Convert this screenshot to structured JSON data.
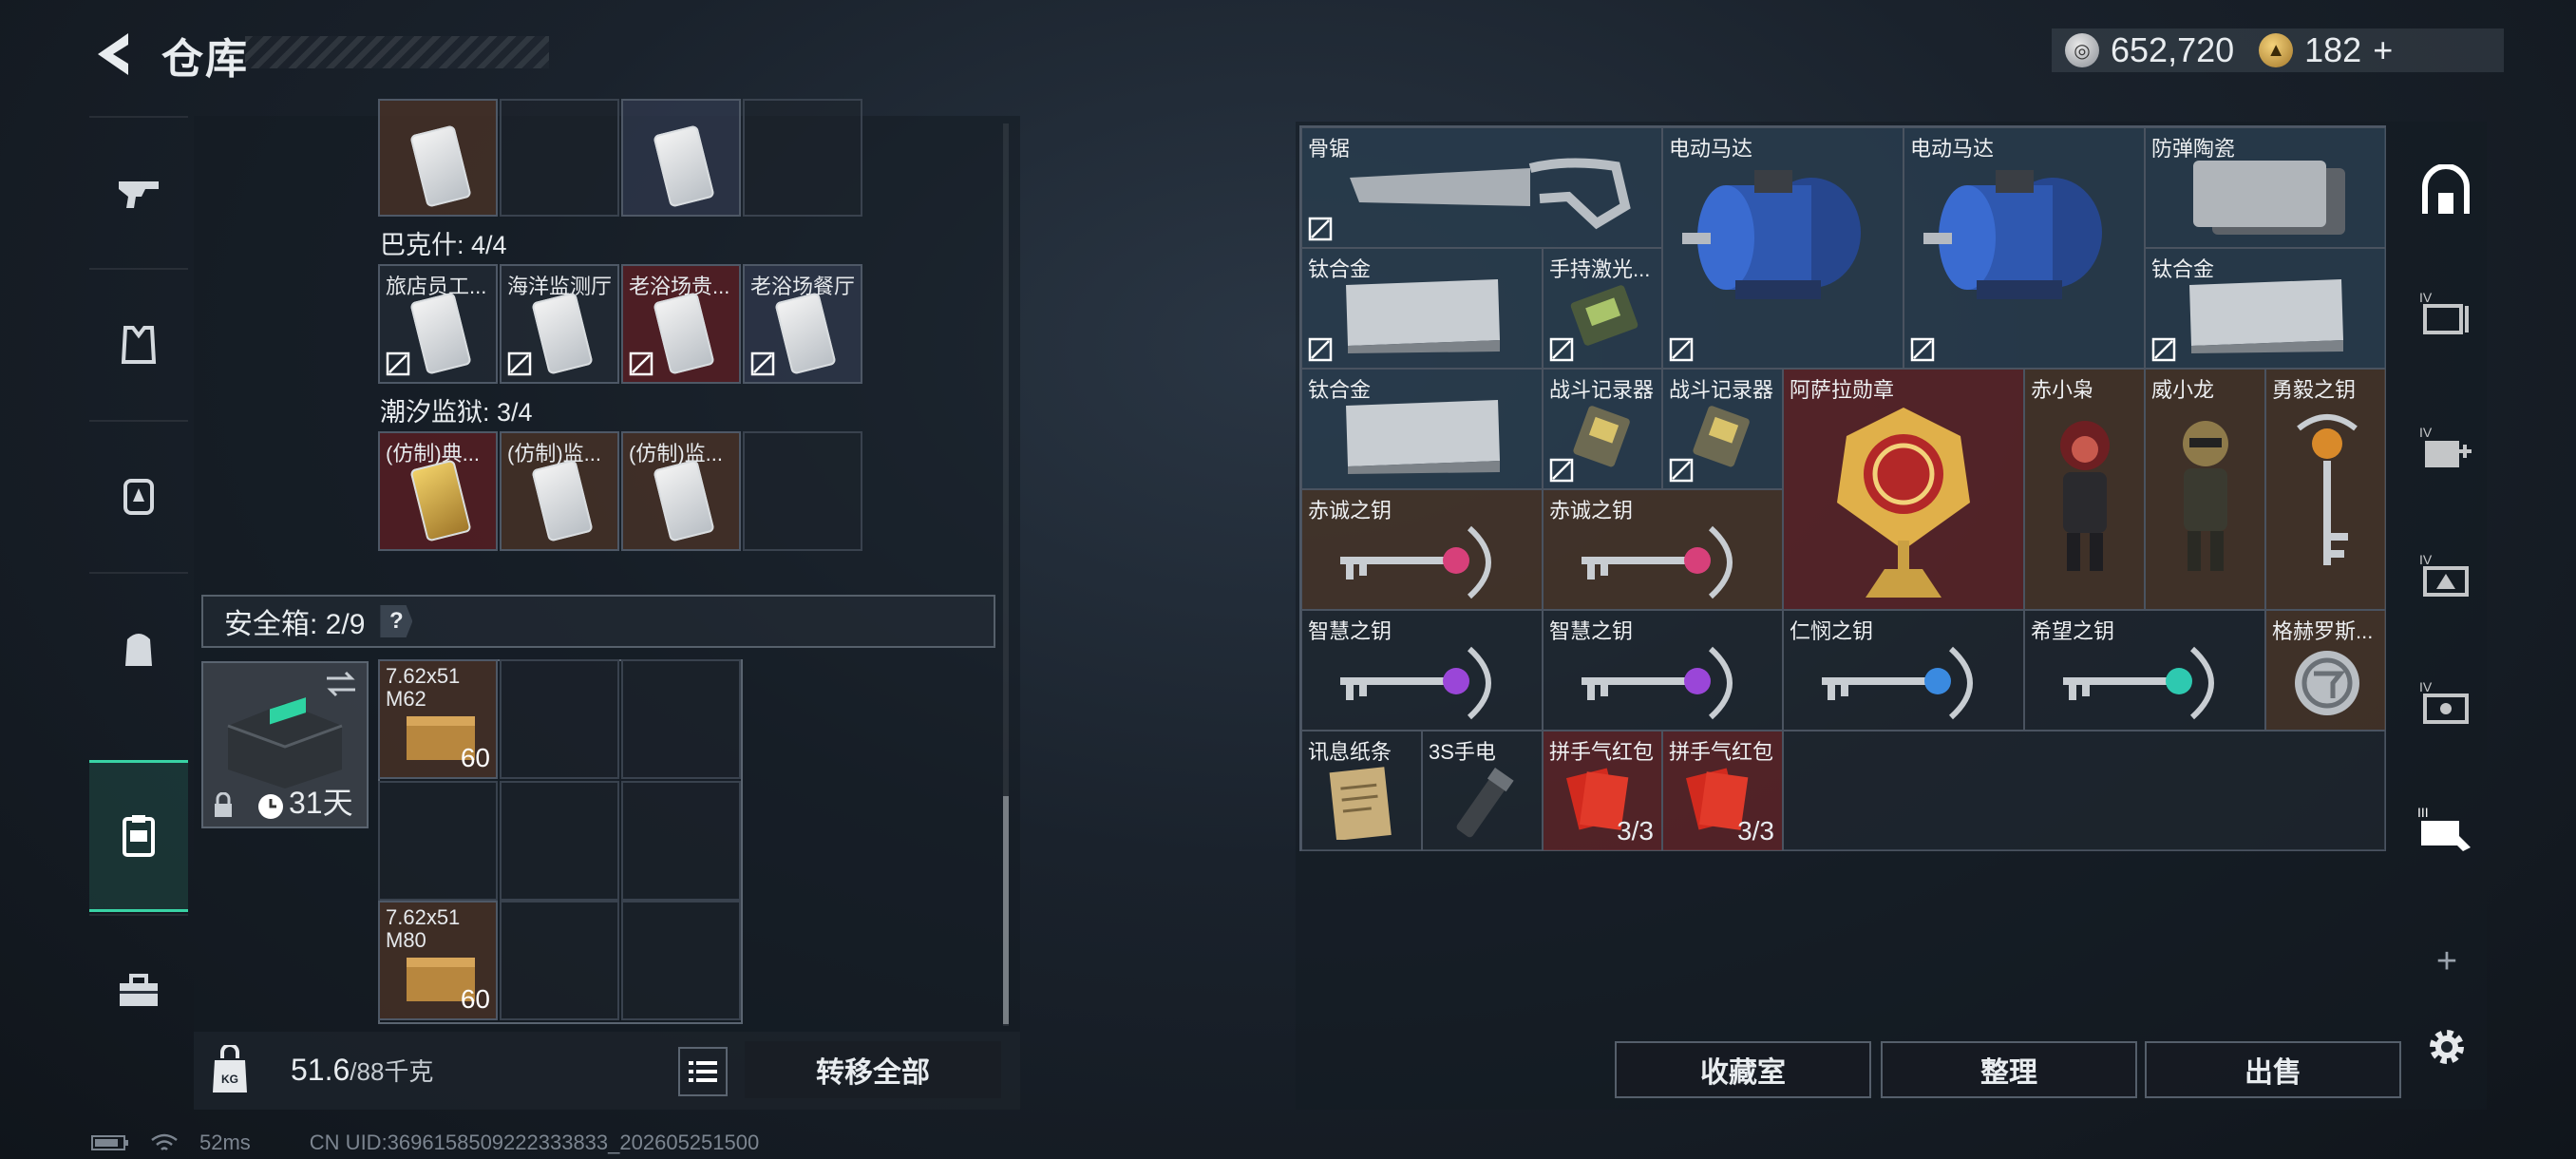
{
  "header": {
    "title": "仓库",
    "silver": "652,720",
    "gold": "182",
    "gold_plus": "+"
  },
  "left": {
    "bakshi_label": "巴克什: 4/4",
    "bakshi_items": [
      "旅店员工...",
      "海洋监测厅",
      "老浴场贵...",
      "老浴场餐厅"
    ],
    "tidal_label": "潮汐监狱: 3/4",
    "tidal_items": [
      "(仿制)典...",
      "(仿制)监...",
      "(仿制)监..."
    ],
    "safe_label": "安全箱: 2/9",
    "safe_q": "?",
    "safe_days": "31天",
    "ammo": [
      {
        "name": "7.62x51 M62",
        "count": "60"
      },
      {
        "name": "7.62x51 M80",
        "count": "60"
      }
    ],
    "weight_value": "51.6",
    "weight_max": "/88千克",
    "transfer_all": "转移全部"
  },
  "right": {
    "items": {
      "bone_saw": "骨锯",
      "motor_1": "电动马达",
      "motor_2": "电动马达",
      "ceramic": "防弹陶瓷",
      "titanium_1": "钛合金",
      "laser": "手持激光...",
      "titanium_2": "钛合金",
      "titanium_3": "钛合金",
      "combat_rec_1": "战斗记录器",
      "combat_rec_2": "战斗记录器",
      "medal": "阿萨拉勋章",
      "owl": "赤小枭",
      "dragon": "威小龙",
      "brave_key": "勇毅之钥",
      "red_key_1": "赤诚之钥",
      "red_key_2": "赤诚之钥",
      "wisdom_key_1": "智慧之钥",
      "wisdom_key_2": "智慧之钥",
      "mercy_key": "仁悯之钥",
      "hope_key": "希望之钥",
      "gerhos": "格赫罗斯...",
      "note": "讯息纸条",
      "flashlight": "3S手电",
      "envelope_1": "拼手气红包",
      "envelope_2": "拼手气红包",
      "envelope_count_1": "3/3",
      "envelope_count_2": "3/3"
    },
    "buttons": {
      "collection": "收藏室",
      "sort": "整理",
      "sell": "出售"
    },
    "plus": "+"
  },
  "status": {
    "ping": "52ms",
    "uid": "CN UID:3696158509222333833_202605251500"
  },
  "colors": {
    "accent": "#39d3a5",
    "red_cell": "#60242a",
    "panel": "#141b23"
  }
}
